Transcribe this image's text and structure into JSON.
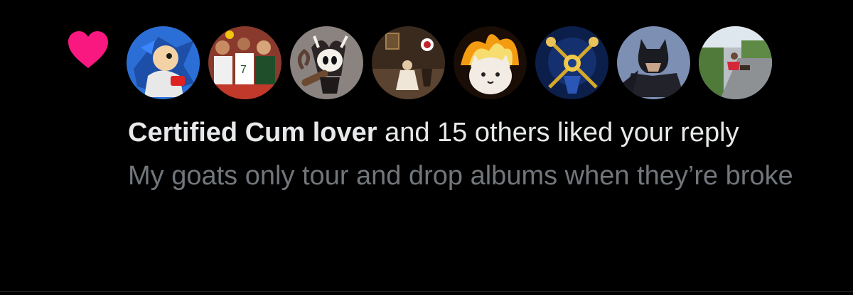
{
  "notification": {
    "type_icon": "heart-icon",
    "heart_color": "#f91880",
    "actor_name": "Certified Cum lover",
    "action_text": " and 15 others liked your reply",
    "reply_preview": "My goats only tour and drop albums when they’re broke",
    "avatars": [
      {
        "name": "avatar-sonic"
      },
      {
        "name": "avatar-crowd"
      },
      {
        "name": "avatar-hollow-knight"
      },
      {
        "name": "avatar-painting"
      },
      {
        "name": "avatar-fire-cat"
      },
      {
        "name": "avatar-keyblade"
      },
      {
        "name": "avatar-batman"
      },
      {
        "name": "avatar-street-photo"
      }
    ]
  },
  "colors": {
    "background": "#000000",
    "primary_text": "#e7e9ea",
    "secondary_text": "#71767b",
    "like_pink": "#f91880"
  }
}
